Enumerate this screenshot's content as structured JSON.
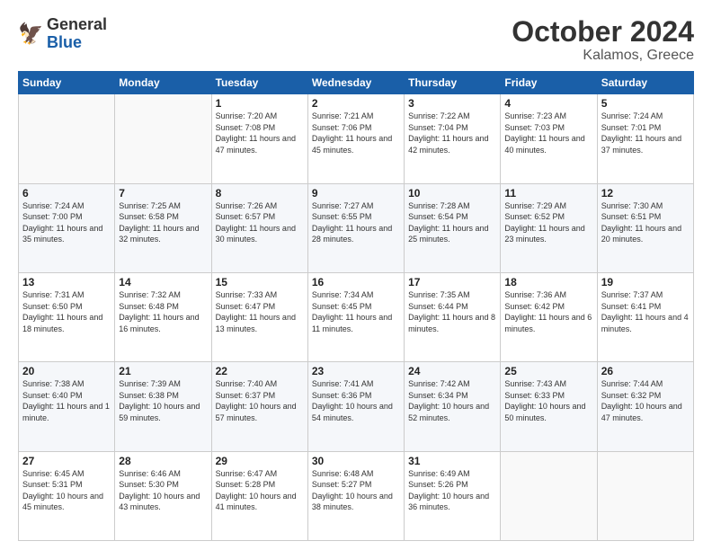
{
  "header": {
    "logo_general": "General",
    "logo_blue": "Blue",
    "month": "October 2024",
    "location": "Kalamos, Greece"
  },
  "weekdays": [
    "Sunday",
    "Monday",
    "Tuesday",
    "Wednesday",
    "Thursday",
    "Friday",
    "Saturday"
  ],
  "weeks": [
    [
      {
        "day": "",
        "info": ""
      },
      {
        "day": "",
        "info": ""
      },
      {
        "day": "1",
        "info": "Sunrise: 7:20 AM\nSunset: 7:08 PM\nDaylight: 11 hours and 47 minutes."
      },
      {
        "day": "2",
        "info": "Sunrise: 7:21 AM\nSunset: 7:06 PM\nDaylight: 11 hours and 45 minutes."
      },
      {
        "day": "3",
        "info": "Sunrise: 7:22 AM\nSunset: 7:04 PM\nDaylight: 11 hours and 42 minutes."
      },
      {
        "day": "4",
        "info": "Sunrise: 7:23 AM\nSunset: 7:03 PM\nDaylight: 11 hours and 40 minutes."
      },
      {
        "day": "5",
        "info": "Sunrise: 7:24 AM\nSunset: 7:01 PM\nDaylight: 11 hours and 37 minutes."
      }
    ],
    [
      {
        "day": "6",
        "info": "Sunrise: 7:24 AM\nSunset: 7:00 PM\nDaylight: 11 hours and 35 minutes."
      },
      {
        "day": "7",
        "info": "Sunrise: 7:25 AM\nSunset: 6:58 PM\nDaylight: 11 hours and 32 minutes."
      },
      {
        "day": "8",
        "info": "Sunrise: 7:26 AM\nSunset: 6:57 PM\nDaylight: 11 hours and 30 minutes."
      },
      {
        "day": "9",
        "info": "Sunrise: 7:27 AM\nSunset: 6:55 PM\nDaylight: 11 hours and 28 minutes."
      },
      {
        "day": "10",
        "info": "Sunrise: 7:28 AM\nSunset: 6:54 PM\nDaylight: 11 hours and 25 minutes."
      },
      {
        "day": "11",
        "info": "Sunrise: 7:29 AM\nSunset: 6:52 PM\nDaylight: 11 hours and 23 minutes."
      },
      {
        "day": "12",
        "info": "Sunrise: 7:30 AM\nSunset: 6:51 PM\nDaylight: 11 hours and 20 minutes."
      }
    ],
    [
      {
        "day": "13",
        "info": "Sunrise: 7:31 AM\nSunset: 6:50 PM\nDaylight: 11 hours and 18 minutes."
      },
      {
        "day": "14",
        "info": "Sunrise: 7:32 AM\nSunset: 6:48 PM\nDaylight: 11 hours and 16 minutes."
      },
      {
        "day": "15",
        "info": "Sunrise: 7:33 AM\nSunset: 6:47 PM\nDaylight: 11 hours and 13 minutes."
      },
      {
        "day": "16",
        "info": "Sunrise: 7:34 AM\nSunset: 6:45 PM\nDaylight: 11 hours and 11 minutes."
      },
      {
        "day": "17",
        "info": "Sunrise: 7:35 AM\nSunset: 6:44 PM\nDaylight: 11 hours and 8 minutes."
      },
      {
        "day": "18",
        "info": "Sunrise: 7:36 AM\nSunset: 6:42 PM\nDaylight: 11 hours and 6 minutes."
      },
      {
        "day": "19",
        "info": "Sunrise: 7:37 AM\nSunset: 6:41 PM\nDaylight: 11 hours and 4 minutes."
      }
    ],
    [
      {
        "day": "20",
        "info": "Sunrise: 7:38 AM\nSunset: 6:40 PM\nDaylight: 11 hours and 1 minute."
      },
      {
        "day": "21",
        "info": "Sunrise: 7:39 AM\nSunset: 6:38 PM\nDaylight: 10 hours and 59 minutes."
      },
      {
        "day": "22",
        "info": "Sunrise: 7:40 AM\nSunset: 6:37 PM\nDaylight: 10 hours and 57 minutes."
      },
      {
        "day": "23",
        "info": "Sunrise: 7:41 AM\nSunset: 6:36 PM\nDaylight: 10 hours and 54 minutes."
      },
      {
        "day": "24",
        "info": "Sunrise: 7:42 AM\nSunset: 6:34 PM\nDaylight: 10 hours and 52 minutes."
      },
      {
        "day": "25",
        "info": "Sunrise: 7:43 AM\nSunset: 6:33 PM\nDaylight: 10 hours and 50 minutes."
      },
      {
        "day": "26",
        "info": "Sunrise: 7:44 AM\nSunset: 6:32 PM\nDaylight: 10 hours and 47 minutes."
      }
    ],
    [
      {
        "day": "27",
        "info": "Sunrise: 6:45 AM\nSunset: 5:31 PM\nDaylight: 10 hours and 45 minutes."
      },
      {
        "day": "28",
        "info": "Sunrise: 6:46 AM\nSunset: 5:30 PM\nDaylight: 10 hours and 43 minutes."
      },
      {
        "day": "29",
        "info": "Sunrise: 6:47 AM\nSunset: 5:28 PM\nDaylight: 10 hours and 41 minutes."
      },
      {
        "day": "30",
        "info": "Sunrise: 6:48 AM\nSunset: 5:27 PM\nDaylight: 10 hours and 38 minutes."
      },
      {
        "day": "31",
        "info": "Sunrise: 6:49 AM\nSunset: 5:26 PM\nDaylight: 10 hours and 36 minutes."
      },
      {
        "day": "",
        "info": ""
      },
      {
        "day": "",
        "info": ""
      }
    ]
  ]
}
